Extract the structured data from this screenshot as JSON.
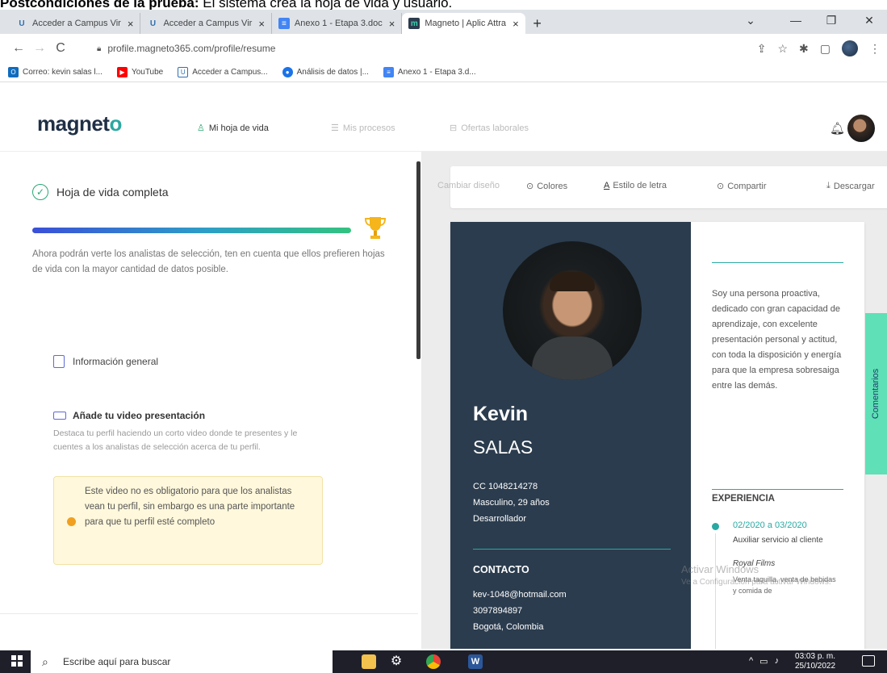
{
  "doc_caption": {
    "bold": "Postcondiciones de la prueba:",
    "text": " El sistema crea la hoja de vida y usuario."
  },
  "browser": {
    "tabs": [
      {
        "label": "Acceder a Campus Vir",
        "icon": "U",
        "active": false
      },
      {
        "label": "Acceder a Campus Vir",
        "icon": "U",
        "active": false
      },
      {
        "label": "Anexo 1 - Etapa 3.doc",
        "icon": "docs",
        "active": false
      },
      {
        "label": "Magneto | Aplic Attra",
        "icon": "m",
        "active": true
      }
    ],
    "url": "profile.magneto365.com/profile/resume",
    "bookmarks": [
      {
        "label": "Correo: kevin salas l...",
        "icon": "outlook-icon",
        "color": "#0f6cbd"
      },
      {
        "label": "YouTube",
        "icon": "youtube-icon",
        "color": "#ff0000"
      },
      {
        "label": "Acceder a Campus...",
        "icon": "campus-icon",
        "color": "#2f6fb0"
      },
      {
        "label": "Análisis de datos |...",
        "icon": "chrome-icon",
        "color": "#1a73e8"
      },
      {
        "label": "Anexo 1 - Etapa 3.d...",
        "icon": "docs-icon",
        "color": "#4285f4"
      }
    ]
  },
  "magneto": {
    "logo": "magneto",
    "nav": [
      {
        "label": "Mi hoja de vida",
        "active": true
      },
      {
        "label": "Mis procesos",
        "active": false
      },
      {
        "label": "Ofertas laborales",
        "active": false
      }
    ]
  },
  "left": {
    "status": "Hoja de vida completa",
    "progress_pct": 100,
    "description": "Ahora podrán verte los analistas de selección, ten en cuenta que ellos prefieren hojas de vida con la mayor cantidad de datos posible.",
    "info_general": "Información general",
    "video_title": "Añade tu video presentación",
    "video_desc": "Destaca tu perfil haciendo un corto video donde te presentes y le cuentes a los analistas de selección acerca de tu perfil.",
    "note": "Este video no es obligatorio para que los analistas vean tu perfil, sin embargo es una parte importante para que tu perfil esté completo"
  },
  "toolbar": {
    "design": "Cambiar diseño",
    "colors": "Colores",
    "font": "Estilo de letra",
    "share": "Compartir",
    "download": "Descargar"
  },
  "cv": {
    "first_name": "Kevin",
    "last_name": "SALAS",
    "id": "CC 1048214278",
    "gender_age": "Masculino, 29 años",
    "title": "Desarrollador",
    "contact_heading": "CONTACTO",
    "email": "kev-1048@hotmail.com",
    "phone": "3097894897",
    "city": "Bogotá, Colombia",
    "about": "Soy una persona proactiva, dedicado con gran capacidad de aprendizaje, con excelente presentación personal y actitud, con toda la disposición y energía para que la empresa sobresaiga entre las demás.",
    "experience_heading": "EXPERIENCIA",
    "exp_date": "02/2020 a 03/2020",
    "exp_role": "Auxiliar servicio al cliente",
    "exp_company": "Royal Films",
    "exp_task": "Venta taquilla, venta de bebidas y comida de"
  },
  "comments_tab": "Comentarios",
  "watermark": {
    "line1": "Activar Windows",
    "line2": "Ve a Configuración para activar Windows."
  },
  "taskbar": {
    "search_placeholder": "Escribe aquí para buscar",
    "time": "03:03 p. m.",
    "date": "25/10/2022"
  }
}
